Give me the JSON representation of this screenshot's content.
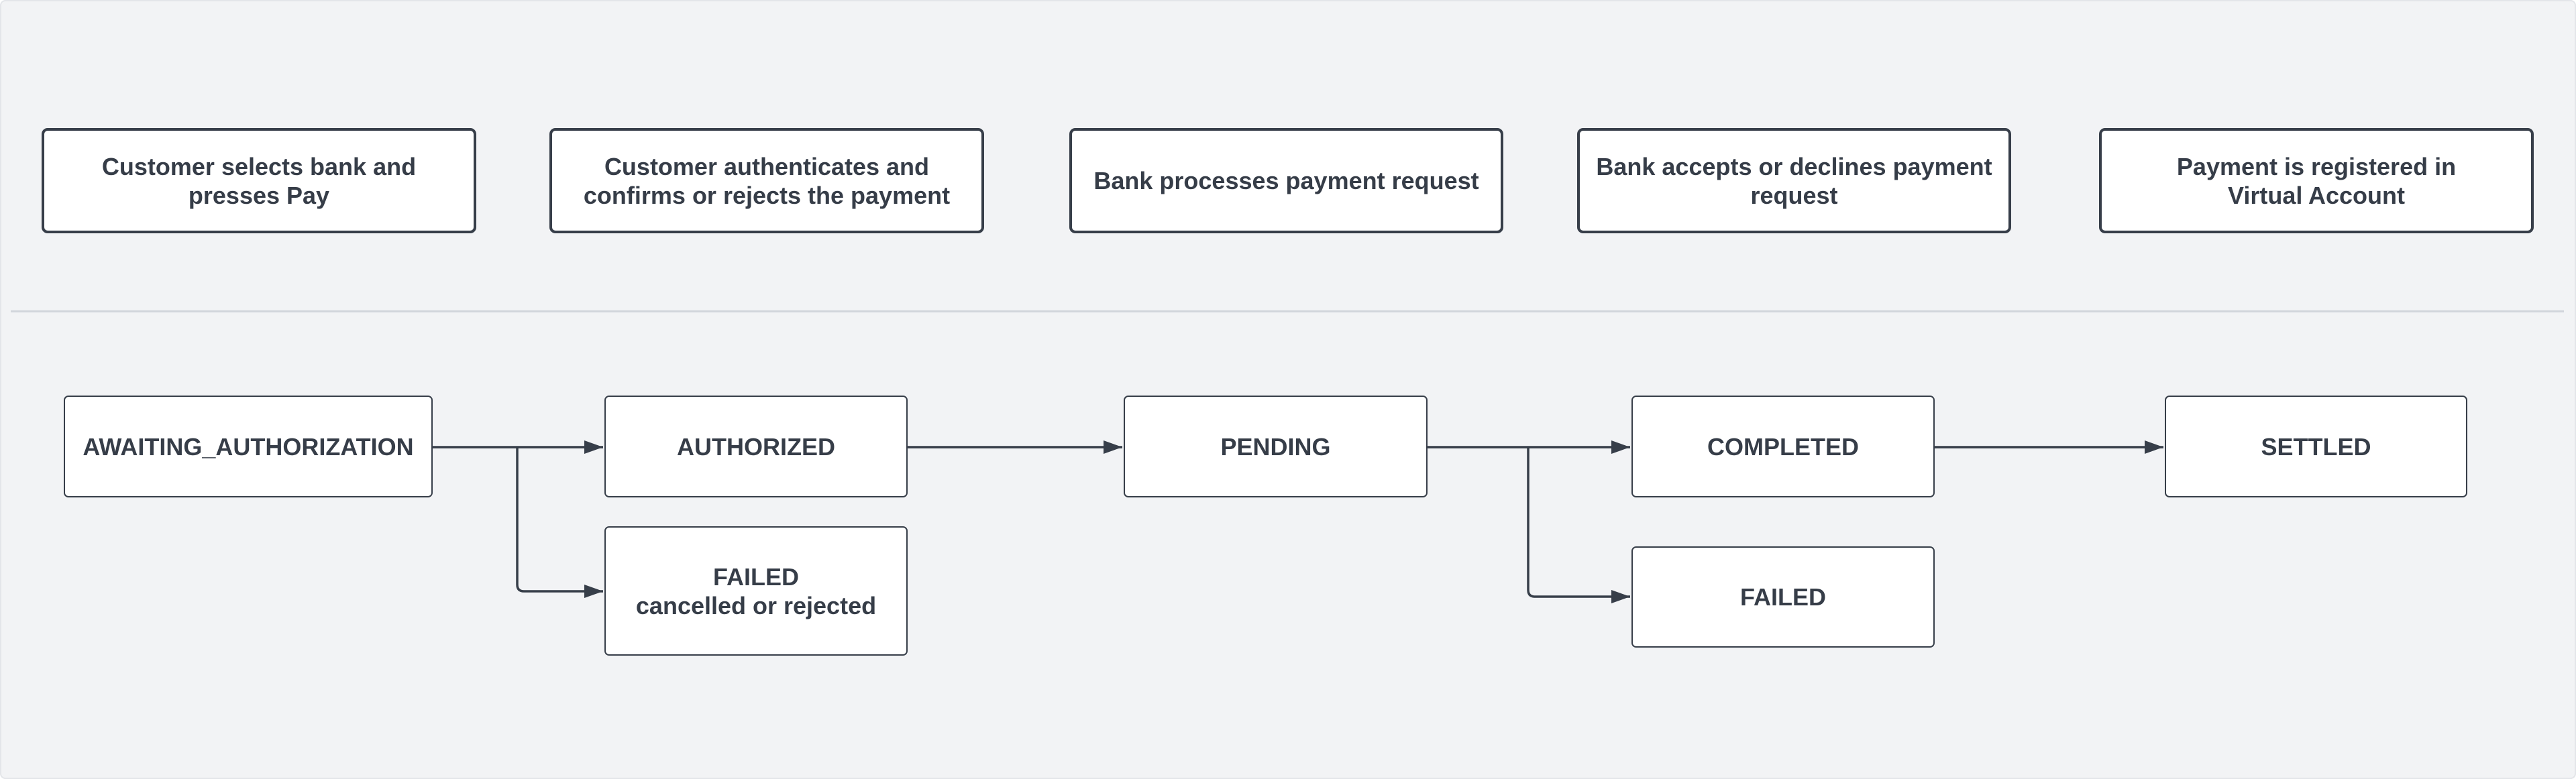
{
  "steps": [
    {
      "label": "Customer selects bank and presses Pay"
    },
    {
      "label": "Customer authenticates and confirms or rejects the payment"
    },
    {
      "label": "Bank processes payment request"
    },
    {
      "label": "Bank accepts or declines payment request"
    },
    {
      "label": "Payment is registered in Virtual Account"
    }
  ],
  "states": {
    "awaiting_authorization": {
      "label": "AWAITING_AUTHORIZATION"
    },
    "authorized": {
      "label": "AUTHORIZED"
    },
    "failed_auth": {
      "label": "FAILED",
      "sublabel": "cancelled or rejected"
    },
    "pending": {
      "label": "PENDING"
    },
    "completed": {
      "label": "COMPLETED"
    },
    "failed_bank": {
      "label": "FAILED"
    },
    "settled": {
      "label": "SETTLED"
    }
  },
  "transitions": [
    {
      "from": "AWAITING_AUTHORIZATION",
      "to": "AUTHORIZED"
    },
    {
      "from": "AWAITING_AUTHORIZATION",
      "to": "FAILED (cancelled or rejected)"
    },
    {
      "from": "AUTHORIZED",
      "to": "PENDING"
    },
    {
      "from": "PENDING",
      "to": "COMPLETED"
    },
    {
      "from": "PENDING",
      "to": "FAILED"
    },
    {
      "from": "COMPLETED",
      "to": "SETTLED"
    }
  ],
  "colors": {
    "background": "#f2f3f5",
    "stroke": "#373e49",
    "text": "#363d48",
    "divider": "#d1d5db"
  }
}
